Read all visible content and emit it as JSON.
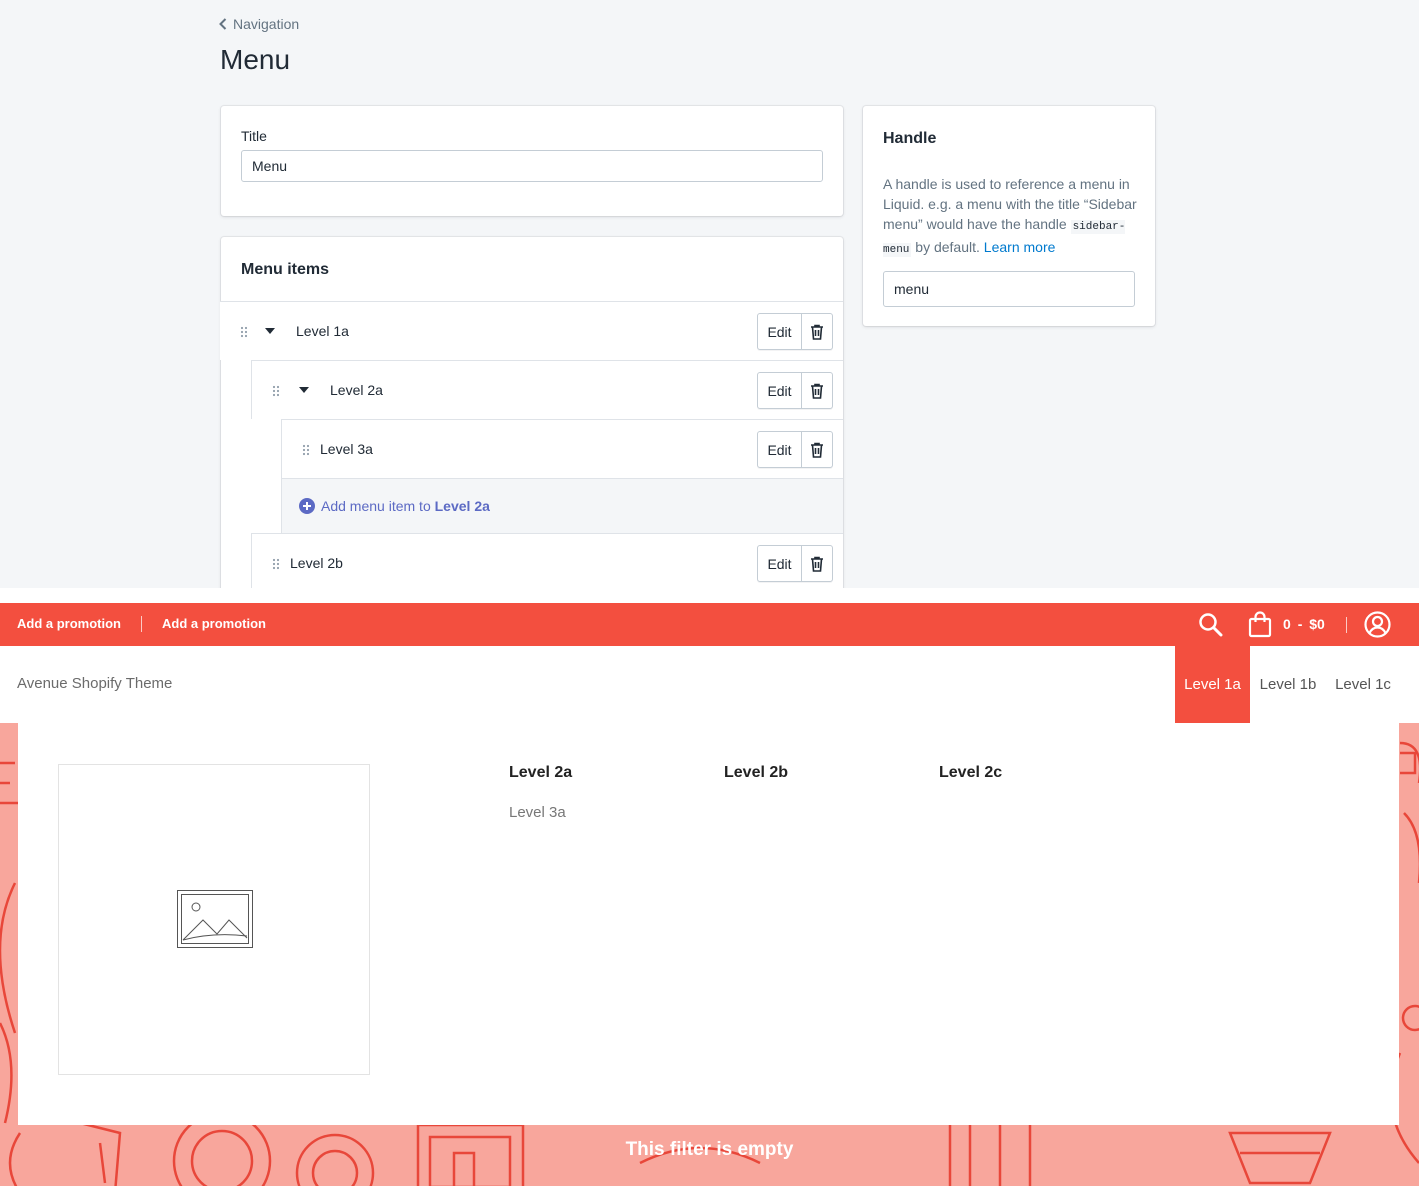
{
  "admin": {
    "breadcrumb": "Navigation",
    "page_title": "Menu",
    "title_card": {
      "label": "Title",
      "value": "Menu"
    },
    "menu_items": {
      "heading": "Menu items",
      "edit_label": "Edit",
      "rows": [
        {
          "label": "Level 1a"
        },
        {
          "label": "Level 2a"
        },
        {
          "label": "Level 3a"
        },
        {
          "label": "Level 2b"
        }
      ],
      "add_item": {
        "prefix": "Add menu item to ",
        "target": "Level 2a"
      }
    },
    "handle_card": {
      "heading": "Handle",
      "desc_before": "A handle is used to reference a menu in Liquid. e.g. a menu with the title “Sidebar menu” would have the handle ",
      "desc_code": "sidebar-menu",
      "desc_after": " by default. ",
      "learn_more": "Learn more",
      "value": "menu"
    }
  },
  "store": {
    "promos": [
      "Add a promotion",
      "Add a promotion"
    ],
    "cart_count": "0",
    "cart_separator": "-",
    "cart_total": "$0",
    "store_name": "Avenue Shopify Theme",
    "nav": [
      "Level 1a",
      "Level 1b",
      "Level 1c"
    ],
    "mega_menu": {
      "columns": [
        {
          "heading": "Level 2a",
          "links": [
            "Level 3a"
          ]
        },
        {
          "heading": "Level 2b",
          "links": []
        },
        {
          "heading": "Level 2c",
          "links": []
        }
      ]
    },
    "empty_message": "This filter is empty"
  },
  "colors": {
    "brand_red": "#f34f3f",
    "pattern_bg": "#f8a69c",
    "admin_link": "#007ace",
    "add_item_link": "#5c6ac4"
  },
  "icons": [
    "chevron-left-icon",
    "drag-handle-icon",
    "caret-down-icon",
    "trash-icon",
    "plus-circle-icon",
    "search-icon",
    "shopping-bag-icon",
    "user-account-icon",
    "image-placeholder-icon"
  ]
}
